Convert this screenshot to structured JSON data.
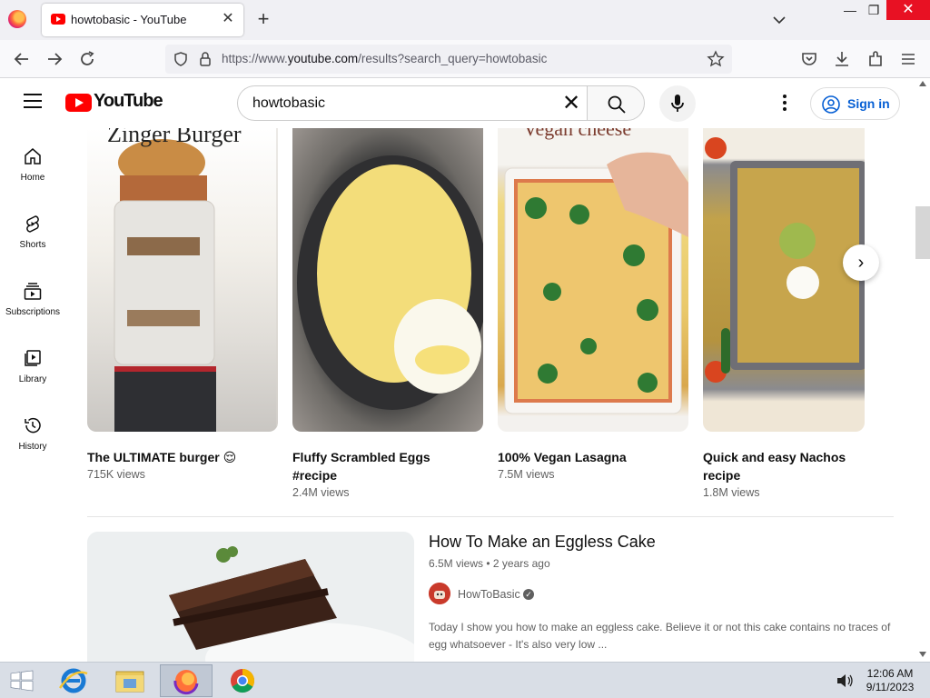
{
  "browser": {
    "tab_title": "howtobasic - YouTube",
    "url_prefix": "https://www.",
    "url_domain": "youtube.com",
    "url_path": "/results?search_query=howtobasic"
  },
  "youtube": {
    "logo_text": "YouTube",
    "search_query": "howtobasic",
    "sign_in_label": "Sign in",
    "guide": [
      {
        "label": "Home",
        "icon": "home-icon"
      },
      {
        "label": "Shorts",
        "icon": "shorts-icon"
      },
      {
        "label": "Subscriptions",
        "icon": "subscriptions-icon"
      },
      {
        "label": "Library",
        "icon": "library-icon"
      },
      {
        "label": "History",
        "icon": "history-icon"
      }
    ],
    "shorts": [
      {
        "title": "The ULTIMATE burger 😌",
        "views": "715K views",
        "thumb_text": "Zinger Burger"
      },
      {
        "title": "Fluffy Scrambled Eggs #recipe",
        "views": "2.4M views"
      },
      {
        "title": "100% Vegan Lasagna",
        "views": "7.5M views",
        "thumb_text": "Vegan cheese"
      },
      {
        "title": "Quick and easy Nachos recipe",
        "views": "1.8M views"
      }
    ],
    "video": {
      "title": "How To Make an Eggless Cake",
      "views": "6.5M views",
      "age": "2 years ago",
      "channel": "HowToBasic",
      "description": "Today I show you how to make an eggless cake. Believe it or not this cake contains no traces of egg whatsoever - It's also very low ..."
    }
  },
  "taskbar": {
    "time": "12:06 AM",
    "date": "9/11/2023"
  },
  "colors": {
    "yt_red": "#ff0000",
    "link_blue": "#065fd4",
    "close_red": "#e81123"
  }
}
